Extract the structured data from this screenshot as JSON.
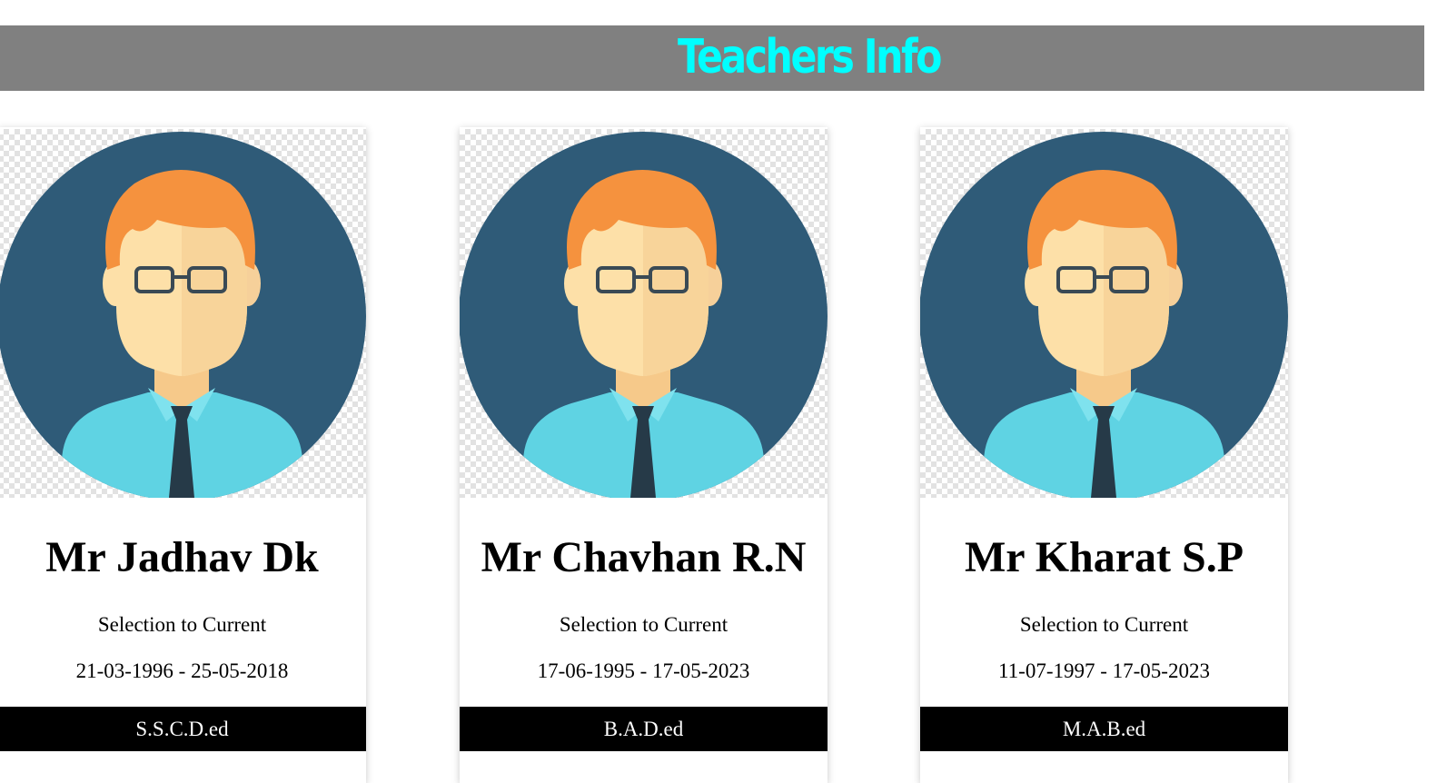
{
  "header": {
    "title": "Teachers Info",
    "bar_color": "#808080",
    "title_color": "#00ffff"
  },
  "cards": [
    {
      "avatar_icon": "teacher-avatar-icon",
      "name": "Mr Jadhav Dk",
      "subtitle": "Selection to Current",
      "dates": "21-03-1996 - 25-05-2018",
      "qualification": "S.S.C.D.ed"
    },
    {
      "avatar_icon": "teacher-avatar-icon",
      "name": "Mr Chavhan R.N",
      "subtitle": "Selection to Current",
      "dates": "17-06-1995 - 17-05-2023",
      "qualification": "B.A.D.ed"
    },
    {
      "avatar_icon": "teacher-avatar-icon",
      "name": "Mr Kharat S.P",
      "subtitle": "Selection to Current",
      "dates": "11-07-1997 - 17-05-2023",
      "qualification": "M.A.B.ed"
    }
  ],
  "colors": {
    "avatar_background": "#2f5b78",
    "hair": "#f5923e",
    "skin": "#fde0a8",
    "shirt": "#5fd3e3",
    "tie": "#263a48",
    "qualification_bar": "#000000"
  }
}
